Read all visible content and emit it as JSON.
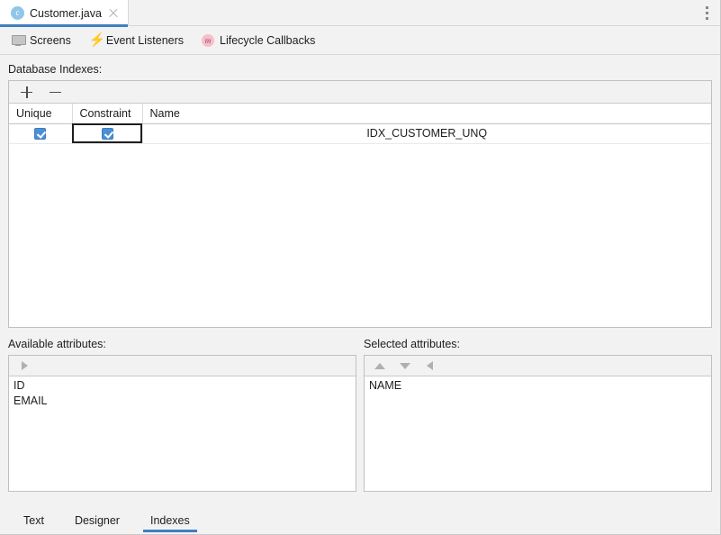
{
  "window": {
    "editor_tab": {
      "title": "Customer.java",
      "file_icon": "c",
      "close_icon": "close-icon"
    },
    "kebab_icon": "more-options-icon"
  },
  "toolbar": {
    "items": [
      {
        "label": "Screens",
        "icon": "monitor-icon"
      },
      {
        "label": "Event Listeners",
        "icon": "lightning-bolt-icon"
      },
      {
        "label": "Lifecycle Callbacks",
        "icon": "method-circle-icon",
        "glyph": "m"
      }
    ]
  },
  "indexes_section": {
    "label": "Database Indexes:",
    "toolbar": {
      "add_icon": "plus-icon",
      "remove_icon": "minus-icon"
    },
    "table": {
      "columns": [
        "Unique",
        "Constraint",
        "Name"
      ],
      "rows": [
        {
          "unique": true,
          "constraint": true,
          "name": "IDX_CUSTOMER_UNQ"
        }
      ]
    }
  },
  "available_attributes": {
    "label": "Available attributes:",
    "toolbar": [
      {
        "icon": "arrow-right-icon"
      }
    ],
    "items": [
      "ID",
      "EMAIL"
    ]
  },
  "selected_attributes": {
    "label": "Selected attributes:",
    "toolbar": [
      {
        "icon": "arrow-up-icon"
      },
      {
        "icon": "arrow-down-icon"
      },
      {
        "icon": "arrow-left-icon"
      }
    ],
    "items": [
      "NAME"
    ]
  },
  "bottom_tabs": {
    "items": [
      "Text",
      "Designer",
      "Indexes"
    ],
    "active": "Indexes"
  },
  "colors": {
    "accent": "#3f7fc1",
    "checkbox": "#4a90d9",
    "panel_bg": "#f2f2f2",
    "content_bg": "#ffffff",
    "bolt": "#f5b91c",
    "callback_badge": "#f7bfc9"
  }
}
